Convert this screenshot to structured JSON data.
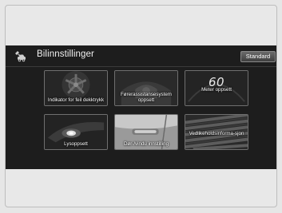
{
  "header": {
    "title": "Bilinnstillinger",
    "icon": "car-settings-icon",
    "default_button_label": "Standard"
  },
  "tiles": [
    {
      "label": "Indikator for feil dekktrykk",
      "icon": "tire-pressure-icon"
    },
    {
      "label": "Førerassistansesystem oppsett",
      "icon": "driver-assist-icon"
    },
    {
      "label": "Meter oppsett",
      "icon": "meter-icon",
      "display_value": "60"
    },
    {
      "label": "Lysoppsett",
      "icon": "headlight-icon"
    },
    {
      "label": "Dør-/vindu innstilling",
      "icon": "door-window-icon"
    },
    {
      "label": "Vedlikeholdsinforma-sjon",
      "icon": "maintenance-icon"
    }
  ]
}
